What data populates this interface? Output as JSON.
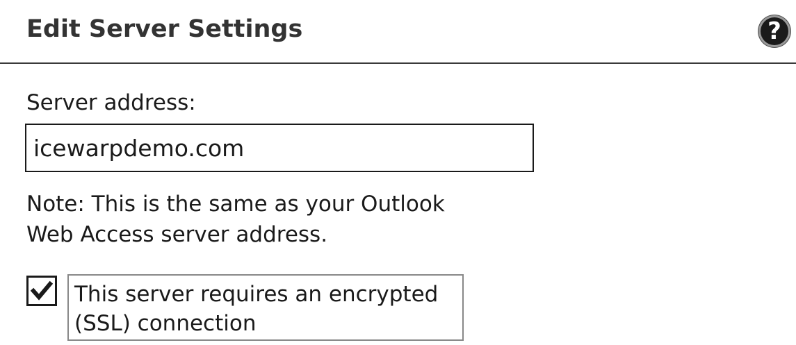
{
  "header": {
    "title": "Edit Server Settings",
    "help_icon_glyph": "?",
    "help_icon": "question-circle-icon"
  },
  "form": {
    "server_address_label": "Server address:",
    "server_address_value": "icewarpdemo.com",
    "note_line1": "Note: This is the same as your Outlook",
    "note_line2": "Web Access server address.",
    "ssl_checkbox_checked": true,
    "ssl_label_line1": "This server requires an encrypted",
    "ssl_label_line2": "(SSL) connection"
  }
}
